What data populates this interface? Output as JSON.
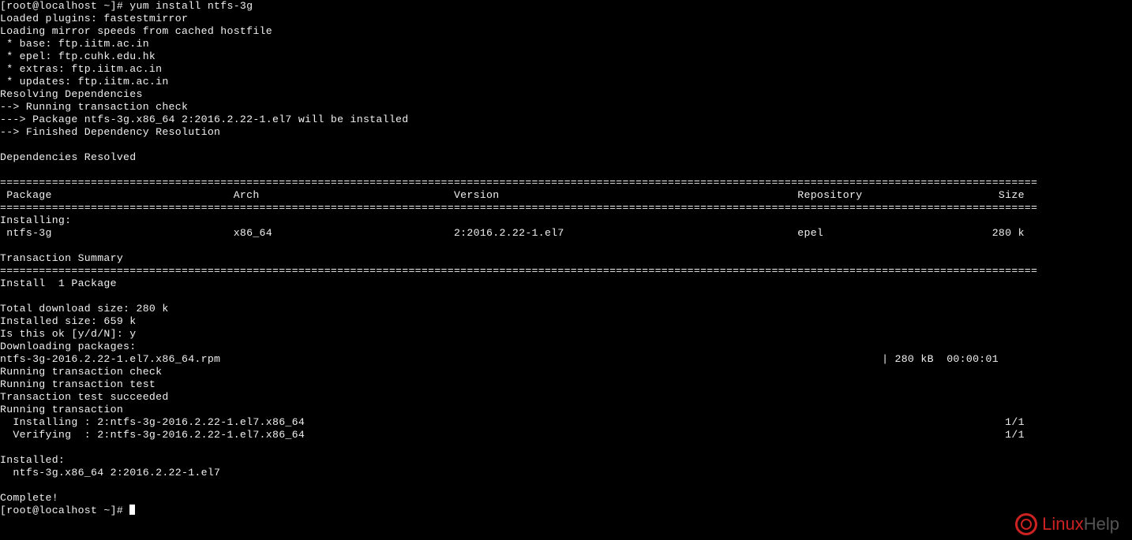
{
  "prompt1": "[root@localhost ~]# ",
  "command": "yum install ntfs-3g",
  "loaded_plugins": "Loaded plugins: fastestmirror",
  "loading_mirror": "Loading mirror speeds from cached hostfile",
  "mirror_base": " * base: ftp.iitm.ac.in",
  "mirror_epel": " * epel: ftp.cuhk.edu.hk",
  "mirror_extras": " * extras: ftp.iitm.ac.in",
  "mirror_updates": " * updates: ftp.iitm.ac.in",
  "resolving": "Resolving Dependencies",
  "run_trans_check": "--> Running transaction check",
  "pkg_will_install": "---> Package ntfs-3g.x86_64 2:2016.2.22-1.el7 will be installed",
  "finished_dep": "--> Finished Dependency Resolution",
  "deps_resolved": "Dependencies Resolved",
  "divider": "================================================================================================================================================================",
  "table_header": " Package                            Arch                              Version                                              Repository                     Size",
  "installing_hdr": "Installing:",
  "pkg_row": " ntfs-3g                            x86_64                            2:2016.2.22-1.el7                                    epel                          280 k",
  "transaction_summary": "Transaction Summary",
  "install_count": "Install  1 Package",
  "total_download": "Total download size: 280 k",
  "installed_size": "Installed size: 659 k",
  "confirm": "Is this ok [y/d/N]: y",
  "downloading": "Downloading packages:",
  "rpm_line": "ntfs-3g-2016.2.22-1.el7.x86_64.rpm                                                                                                      | 280 kB  00:00:01",
  "run_check2": "Running transaction check",
  "run_test": "Running transaction test",
  "test_succeeded": "Transaction test succeeded",
  "run_trans": "Running transaction",
  "installing_step": "  Installing : 2:ntfs-3g-2016.2.22-1.el7.x86_64                                                                                                            1/1",
  "verifying_step": "  Verifying  : 2:ntfs-3g-2016.2.22-1.el7.x86_64                                                                                                            1/1",
  "installed_hdr": "Installed:",
  "installed_pkg": "  ntfs-3g.x86_64 2:2016.2.22-1.el7",
  "complete": "Complete!",
  "prompt2": "[root@localhost ~]# ",
  "watermark": {
    "brand1": "Linux",
    "brand2": "Help"
  }
}
